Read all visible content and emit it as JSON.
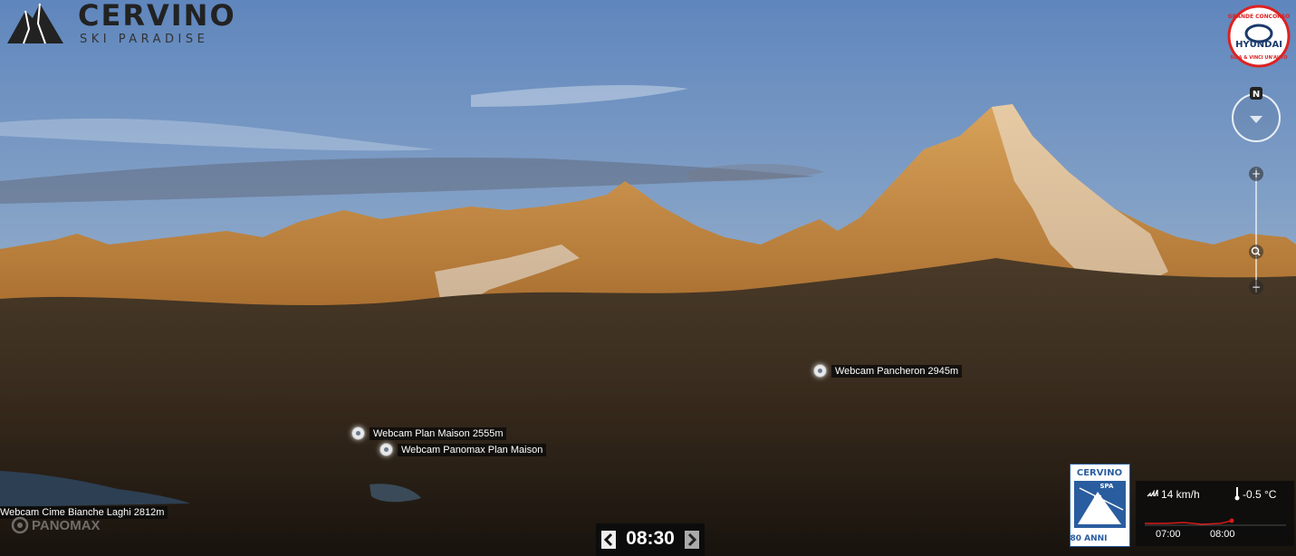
{
  "brand": {
    "name": "CERVINO",
    "subtitle": "SKI PARADISE"
  },
  "sponsor": {
    "line1": "GRANDE CONCORSO",
    "name": "HYUNDAI",
    "line2": "SCIA & VINCI UN'AUTO"
  },
  "compass": {
    "north": "N"
  },
  "zoom": {
    "in": "+",
    "out": "−"
  },
  "webcams": [
    {
      "label": "Webcam Pancheron 2945m"
    },
    {
      "label": "Webcam Plan Maison 2555m"
    },
    {
      "label": "Webcam Panomax Plan Maison"
    },
    {
      "label": "Webcam Cime Bianche Laghi 2812m"
    }
  ],
  "timebar": {
    "time": "08:30"
  },
  "watermark": "PANOMAX",
  "badge": {
    "name": "CERVINO",
    "sub": "SPA",
    "years": "80 ANNI"
  },
  "weather": {
    "wind": "14 km/h",
    "temperature": "-0.5 °C",
    "times": [
      "07:00",
      "08:00"
    ]
  },
  "colors": {
    "sky": "#6f93c3",
    "mountain_lit": "#c98a3a",
    "label_bg": "#0a0a0a"
  }
}
